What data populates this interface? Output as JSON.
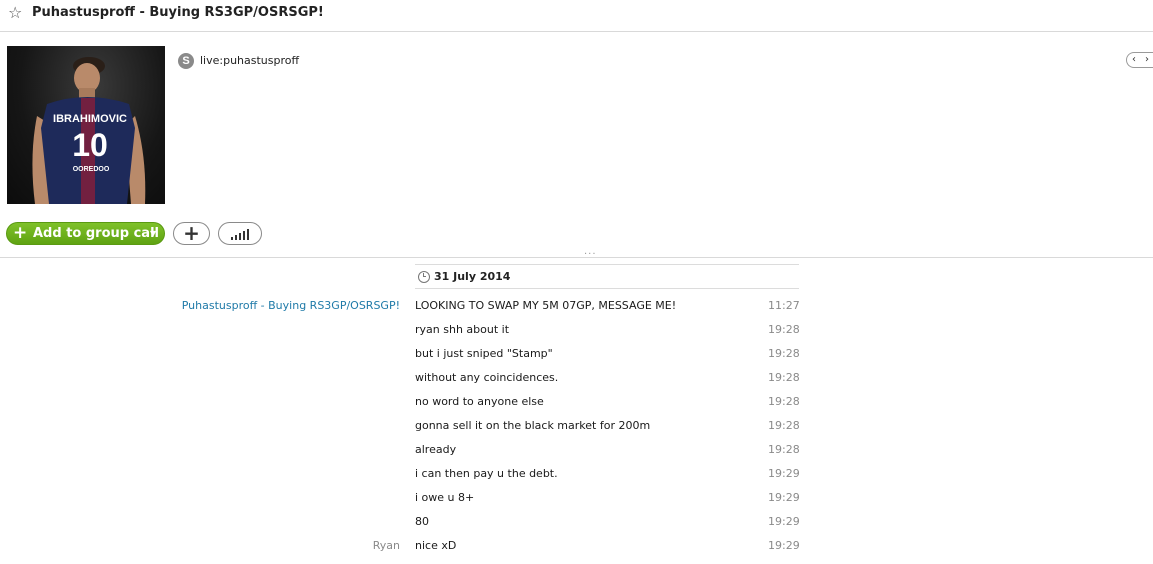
{
  "header": {
    "title": "Puhastusproff - Buying RS3GP/OSRSGP!",
    "star_icon": "star-outline-icon"
  },
  "profile": {
    "jersey_name": "IBRAHIMOVIC",
    "jersey_number": "10",
    "sponsor": "OOREDOO",
    "skype_id": "live:puhastusproff",
    "skype_icon_glyph": "S"
  },
  "actions": {
    "call_label": "Add to group call",
    "call_plus": "+",
    "call_caret": "▼",
    "add_glyph": "+",
    "nav_left": "‹",
    "nav_right": "›",
    "accent_color": "#6cb31b"
  },
  "conversation": {
    "grip": "...",
    "date": "31 July 2014",
    "messages": [
      {
        "sender": "Puhastusproff - Buying RS3GP/OSRSGP!",
        "text": "LOOKING TO SWAP MY 5M 07GP, MESSAGE ME!",
        "time": "11:27"
      },
      {
        "sender": "",
        "text": "ryan shh about it",
        "time": "19:28"
      },
      {
        "sender": "",
        "text": "but i just sniped \"Stamp\"",
        "time": "19:28"
      },
      {
        "sender": "",
        "text": "without any coincidences.",
        "time": "19:28"
      },
      {
        "sender": "",
        "text": "no word to anyone else",
        "time": "19:28"
      },
      {
        "sender": "",
        "text": "gonna sell it on the black market for 200m",
        "time": "19:28"
      },
      {
        "sender": "",
        "text": "already",
        "time": "19:28"
      },
      {
        "sender": "",
        "text": "i can then pay u the debt.",
        "time": "19:29"
      },
      {
        "sender": "",
        "text": "i owe u 8+",
        "time": "19:29"
      },
      {
        "sender": "",
        "text": "80",
        "time": "19:29"
      },
      {
        "sender": "Ryan",
        "text": "nice xD",
        "time": "19:29"
      }
    ]
  }
}
